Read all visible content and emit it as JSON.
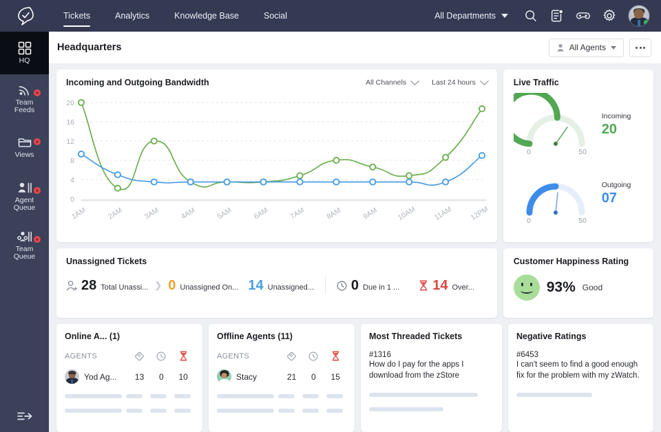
{
  "topbar": {
    "logo_icon": "zoho-desk-logo-icon",
    "tabs": [
      {
        "label": "Tickets",
        "active": true
      },
      {
        "label": "Analytics",
        "active": false
      },
      {
        "label": "Knowledge Base",
        "active": false
      },
      {
        "label": "Social",
        "active": false
      }
    ],
    "department": "All Departments",
    "icons": [
      "search-icon",
      "notes-icon",
      "gamification-icon",
      "gear-icon"
    ],
    "avatar": "user-avatar",
    "status": "online"
  },
  "sidebar": {
    "items": [
      {
        "label": "HQ",
        "icon": "grid-icon",
        "active": true,
        "badge": false
      },
      {
        "label": "Team\nFeeds",
        "label_line1": "Team",
        "label_line2": "Feeds",
        "icon": "feed-icon",
        "active": false,
        "badge": true
      },
      {
        "label": "Views",
        "label_line1": "Views",
        "label_line2": "",
        "icon": "folder-icon",
        "active": false,
        "badge": true
      },
      {
        "label": "Agent Queue",
        "label_line1": "Agent",
        "label_line2": "Queue",
        "icon": "agent-queue-icon",
        "active": false,
        "badge": true
      },
      {
        "label": "Team Queue",
        "label_line1": "Team",
        "label_line2": "Queue",
        "icon": "team-queue-icon",
        "active": false,
        "badge": true
      }
    ],
    "collapse_icon": "expand-sidebar-icon"
  },
  "header": {
    "title": "Headquarters",
    "agents_filter": "All Agents",
    "more_label": "more-options"
  },
  "chart_card": {
    "title": "Incoming and Outgoing Bandwidth",
    "channel_filter": "All Channels",
    "time_filter": "Last 24 hours"
  },
  "chart_data": {
    "type": "line",
    "title": "Incoming and Outgoing Bandwidth",
    "xlabel": "",
    "ylabel": "",
    "ylim": [
      0,
      20
    ],
    "yticks": [
      0,
      4,
      8,
      12,
      16,
      20
    ],
    "grid": true,
    "legend": "none",
    "categories": [
      "1AM",
      "2AM",
      "3AM",
      "4AM",
      "5AM",
      "6AM",
      "7AM",
      "8AM",
      "9AM",
      "10AM",
      "11AM",
      "12PM"
    ],
    "series": [
      {
        "name": "Incoming",
        "color": "#6cb04f",
        "values": [
          20,
          2.2,
          12,
          3.5,
          3.5,
          3.5,
          4.8,
          8,
          6.6,
          4.8,
          8.6,
          18.7
        ]
      },
      {
        "name": "Outgoing",
        "color": "#4a9de3",
        "values": [
          9.3,
          5,
          3.5,
          3.5,
          3.5,
          3.5,
          3.5,
          3.5,
          3.5,
          3.5,
          3.5,
          9
        ]
      }
    ]
  },
  "live_traffic": {
    "title": "Live Traffic",
    "gauges": [
      {
        "label": "Incoming",
        "value": "20",
        "min": "0",
        "max": "50",
        "color": "#52a852",
        "fraction": 0.52
      },
      {
        "label": "Outgoing",
        "value": "07",
        "min": "0",
        "max": "50",
        "color": "#3d8ce8",
        "fraction": 0.5
      }
    ]
  },
  "unassigned": {
    "title": "Unassigned Tickets",
    "metrics": [
      {
        "icon": "add-user-icon",
        "value": "28",
        "label": "Total Unassi...",
        "color": "#1b1d22"
      },
      {
        "icon": "",
        "value": "0",
        "label": "Unassigned On...",
        "color": "#f0a12e"
      },
      {
        "icon": "",
        "value": "14",
        "label": "Unassigned...",
        "color": "#4a9de3"
      },
      {
        "icon": "clock-icon",
        "value": "0",
        "label": "Due in 1 ...",
        "color": "#1b1d22"
      },
      {
        "icon": "hourglass-icon",
        "value": "14",
        "label": "Over...",
        "color": "#e0453e"
      }
    ]
  },
  "happiness": {
    "title": "Customer Happiness Rating",
    "icon": "happy-face-icon",
    "percent": "93%",
    "rating_label": "Good"
  },
  "online_agents": {
    "title": "Online A... (1)",
    "col_agents": "AGENTS",
    "col_icons": [
      "ticket-icon",
      "clock-icon",
      "hourglass-icon"
    ],
    "rows": [
      {
        "name": "Yod Ag...",
        "tickets": "13",
        "due": "0",
        "overdue": "10"
      }
    ]
  },
  "offline_agents": {
    "title": "Offline Agents (11)",
    "col_agents": "AGENTS",
    "col_icons": [
      "ticket-icon",
      "clock-icon",
      "hourglass-icon"
    ],
    "rows": [
      {
        "name": "Stacy",
        "tickets": "21",
        "due": "0",
        "overdue": "15"
      }
    ]
  },
  "most_threaded": {
    "title": "Most Threaded Tickets",
    "ticket_id": "#1316",
    "ticket_subject": "How do I pay for the apps I download from the zStore"
  },
  "negative_ratings": {
    "title": "Negative Ratings",
    "ticket_id": "#6453",
    "ticket_subject": "I can't seem to find a good enough fix for the problem with my zWatch."
  },
  "colors": {
    "topbar_bg": "#343a52",
    "sidebar_bg": "#3b4159",
    "sidebar_active": "#0b0d14",
    "page_bg": "#eef0f4",
    "green": "#6cb04f",
    "blue": "#4a9de3",
    "red": "#e0453e",
    "orange": "#f0a12e"
  }
}
